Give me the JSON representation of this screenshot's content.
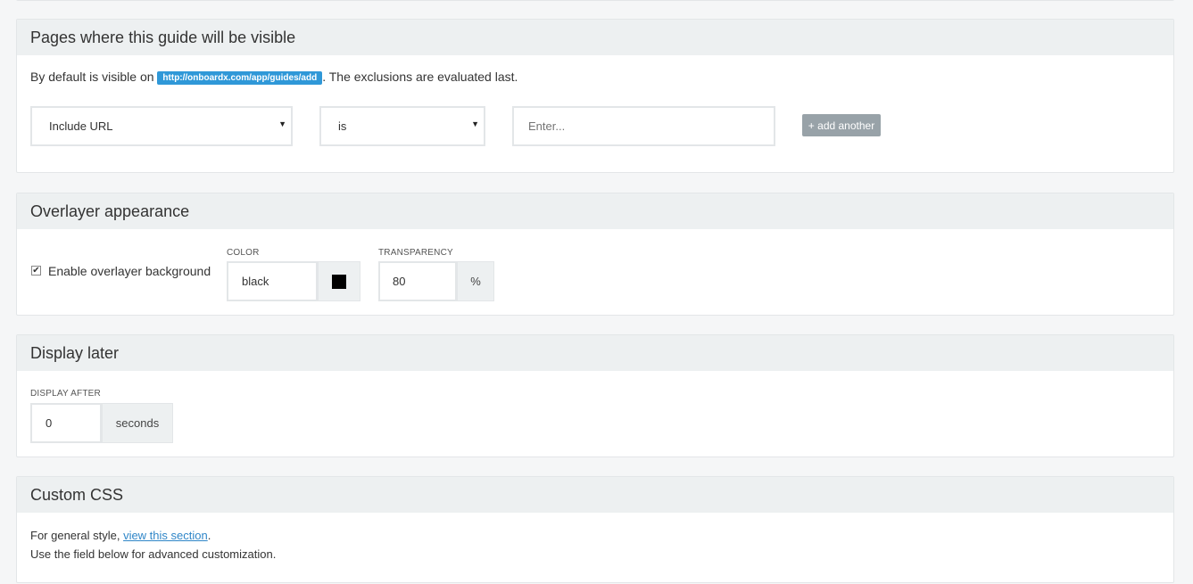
{
  "pages_section": {
    "title": "Pages where this guide will be visible",
    "intro_prefix": "By default is visible on",
    "url_tag": "http://onboardx.com/app/guides/add",
    "intro_suffix": ". The exclusions are evaluated last.",
    "rule_type": "Include URL",
    "operator": "is",
    "url_placeholder": "Enter...",
    "add_button": "+ add another"
  },
  "overlayer_section": {
    "title": "Overlayer appearance",
    "enable_label": "Enable overlayer background",
    "enable_checked": true,
    "color_label": "COLOR",
    "color_value": "black",
    "color_swatch": "#000000",
    "transparency_label": "TRANSPARENCY",
    "transparency_value": "80",
    "transparency_unit": "%"
  },
  "display_later_section": {
    "title": "Display later",
    "display_after_label": "DISPLAY AFTER",
    "display_after_value": "0",
    "display_after_unit": "seconds"
  },
  "custom_css_section": {
    "title": "Custom CSS",
    "general_prefix": "For general style,",
    "general_link": "view this section",
    "general_suffix": ".",
    "advanced_text": "Use the field below for advanced customization."
  }
}
